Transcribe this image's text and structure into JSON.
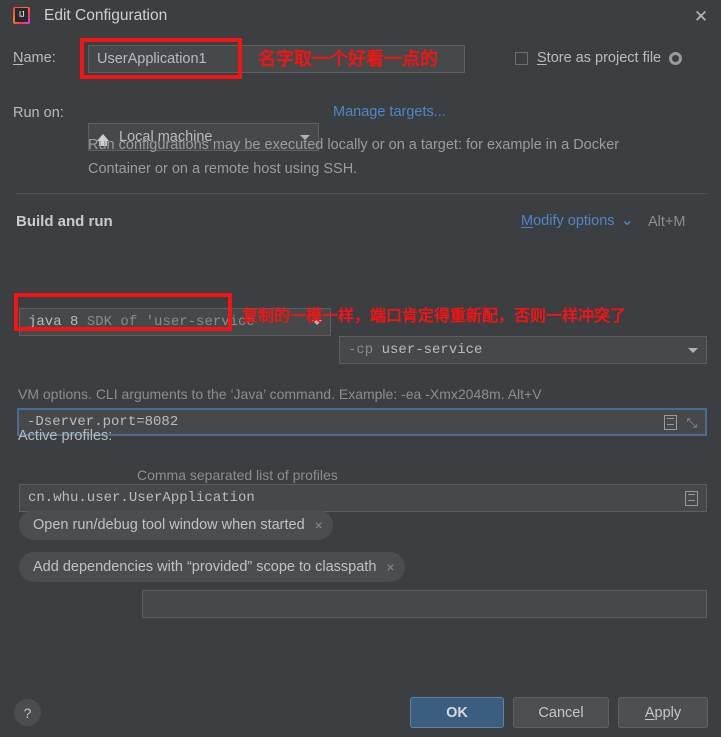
{
  "window": {
    "title": "Edit Configuration",
    "app_icon": "intellij-idea-logo",
    "close_icon": "✕"
  },
  "name_row": {
    "label": "Name:",
    "label_mnemonic": "N",
    "value": "UserApplication1",
    "store_as_project_file_label": "Store as project file",
    "store_as_project_file_mnemonic": "S",
    "store_as_project_file_checked": false,
    "gear_icon": "gear-icon"
  },
  "run_on_row": {
    "label": "Run on:",
    "value": "Local machine",
    "value_icon": "home-icon",
    "manage_targets_link": "Manage targets...",
    "description": "Run configurations may be executed locally or on a target: for example in a Docker Container or on a remote host using SSH."
  },
  "build_and_run": {
    "section_title": "Build and run",
    "modify_options_link": "Modify options",
    "modify_options_mnemonic": "M",
    "modify_options_chevron": "⌄",
    "modify_options_shortcut": "Alt+M",
    "jre": {
      "primary": "java 8",
      "secondary": "SDK of 'user-service"
    },
    "module": {
      "prefix": "-cp",
      "value": "user-service"
    },
    "vm_options": {
      "value": "-Dserver.port=8082",
      "copy_icon": "document-icon",
      "expand_icon": "expand-arrows-icon"
    },
    "main_class": {
      "value": "cn.whu.user.UserApplication",
      "browse_icon": "list-browse-icon"
    },
    "vm_options_hint": "VM options. CLI arguments to the ‘Java’ command. Example: -ea -Xmx2048m. Alt+V"
  },
  "active_profiles": {
    "label": "Active profiles:",
    "value": "",
    "hint": "Comma separated list of profiles"
  },
  "chips": [
    {
      "label": "Open run/debug tool window when started",
      "close_icon": "×"
    },
    {
      "label": "Add dependencies with “provided” scope to classpath",
      "close_icon": "×"
    }
  ],
  "footer": {
    "help_label": "?",
    "ok_label": "OK",
    "cancel_label": "Cancel",
    "apply_label": "Apply",
    "apply_mnemonic": "A"
  },
  "annotations": {
    "color": "#f41414",
    "name_note": "名字取一个好看一点的",
    "vm_note": "复制的一模一样，端口肯定得重新配，否则一样冲突了"
  }
}
